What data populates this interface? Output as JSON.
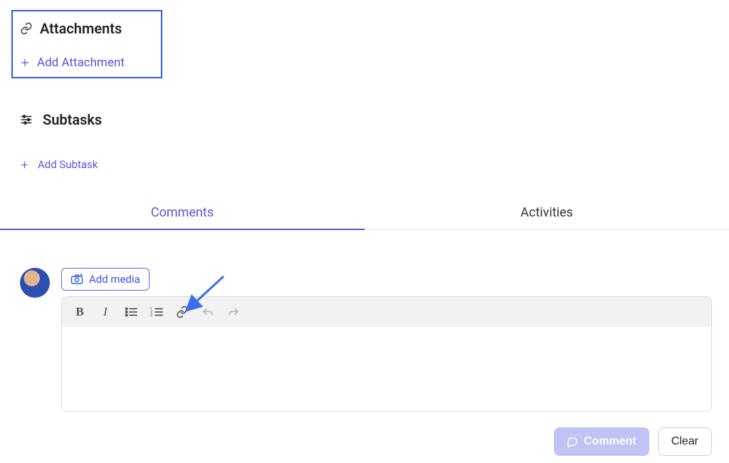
{
  "attachments": {
    "heading": "Attachments",
    "add_label": "Add Attachment"
  },
  "subtasks": {
    "heading": "Subtasks",
    "add_label": "Add Subtask"
  },
  "tabs": {
    "comments": "Comments",
    "activities": "Activities",
    "active": "comments"
  },
  "editor": {
    "add_media_label": "Add media",
    "toolbar": {
      "bold": "B",
      "italic": "I"
    }
  },
  "actions": {
    "comment_label": "Comment",
    "clear_label": "Clear"
  },
  "colors": {
    "accent": "#5a51e0",
    "highlight_border": "#2f58ff"
  }
}
